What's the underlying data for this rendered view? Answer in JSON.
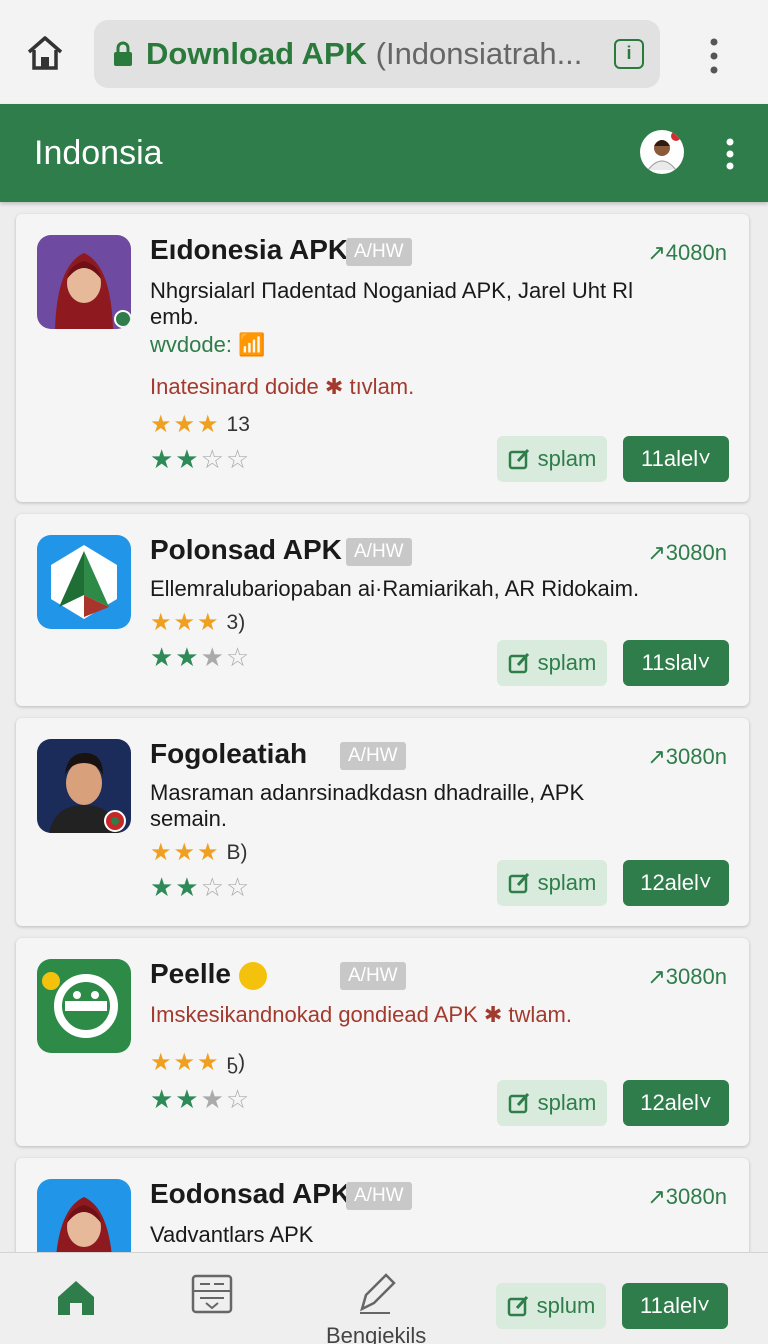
{
  "browser": {
    "url_main": "Download APK",
    "url_rest": " (Indonsiatrah...",
    "info_label": "i"
  },
  "app_bar": {
    "title": "Indonsia"
  },
  "apps": [
    {
      "name": "Eıdonesia APK",
      "badge": "A/HW",
      "meta": "↗4080n",
      "desc": "Nhgrsialarl Пadentad Noganiad APK, Jarel Uht Rl emb.",
      "subinfo": "wvdode:",
      "desc2": "Inatesinard doide ✱ tıvlam.",
      "rating": "13",
      "btn_secondary": "splam",
      "btn_primary": "11alel˅",
      "icon": "woman-hijab-avatar"
    },
    {
      "name": "Polonsad APK",
      "badge": "A/HW",
      "meta": "↗3080n",
      "desc": "Ellemralubariopaban ai·Ramiarikah, AR Ridokaim.",
      "rating": "3)",
      "btn_secondary": "splam",
      "btn_primary": "11slal˅",
      "icon": "tree-logo"
    },
    {
      "name": "Fogoleatiah",
      "badge": "A/HW",
      "meta": "↗3080n",
      "desc": "Masraman adanrsinadkdasn dhadraille, APK semain.",
      "rating": "B)",
      "btn_secondary": "splam",
      "btn_primary": "12alel˅",
      "icon": "man-avatar"
    },
    {
      "name": "Peelle",
      "badge": "A/HW",
      "meta": "↗3080n",
      "desc": "Imskesikandnokad gondiead APK ✱ twlam.",
      "rating": "ҕ)",
      "btn_secondary": "splam",
      "btn_primary": "12alel˅",
      "icon": "robot-logo"
    },
    {
      "name": "Eodonsad APK",
      "badge": "A/HW",
      "meta": "↗3080n",
      "desc": "Vadvantlars APK",
      "icon": "woman-hijab-avatar"
    }
  ],
  "bottom_nav": {
    "label": "Bengiekils",
    "btn_secondary": "splum",
    "btn_primary": "11alel˅"
  },
  "colors": {
    "brand_green": "#2e7d4a",
    "light_green": "#d8ebdd",
    "star_orange": "#f0a020",
    "red_text": "#a33a2e"
  }
}
